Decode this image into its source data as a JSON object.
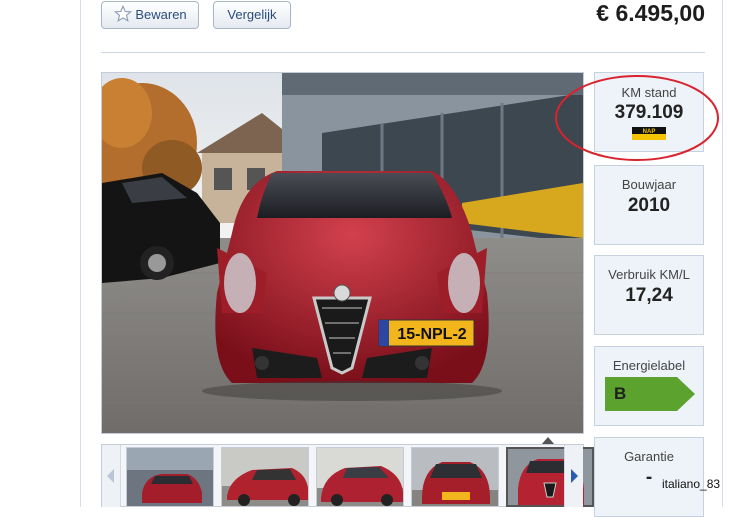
{
  "toolbar": {
    "save_label": "Bewaren",
    "compare_label": "Vergelijk"
  },
  "listing": {
    "price": "€ 6.495,00"
  },
  "specs": {
    "mileage": {
      "label": "KM stand",
      "value": "379.109",
      "badge": "NAP"
    },
    "year": {
      "label": "Bouwjaar",
      "value": "2010"
    },
    "consumption": {
      "label": "Verbruik KM/L",
      "value": "17,24"
    },
    "energy": {
      "label": "Energielabel",
      "value": "B",
      "color": "#5ca22e"
    },
    "warranty": {
      "label": "Garantie",
      "value": "-"
    }
  },
  "photo": {
    "plate": "15-NPL-2"
  },
  "thumbnails": {
    "count": 5,
    "active_index": 4
  },
  "annotation": {
    "color": "#d9232e"
  },
  "watermark": {
    "text": "italiano_83"
  },
  "icons": [
    "star-icon",
    "arrow-left-icon",
    "arrow-right-icon",
    "nap-logo-icon"
  ]
}
